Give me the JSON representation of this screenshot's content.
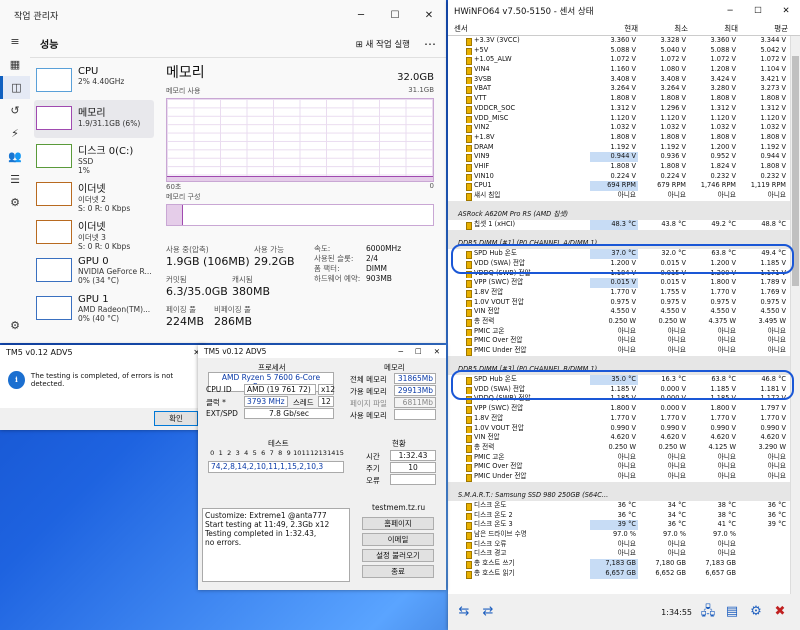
{
  "task_manager": {
    "title": "작업 관리자",
    "section": "성능",
    "new_task": "새 작업 실행",
    "items": [
      {
        "name": "CPU",
        "sub1": "2% 4.40GHz",
        "sub2": ""
      },
      {
        "name": "메모리",
        "sub1": "1.9/31.1GB (6%)",
        "sub2": ""
      },
      {
        "name": "디스크 0(C:)",
        "sub1": "SSD",
        "sub2": "1%"
      },
      {
        "name": "이더넷",
        "sub1": "이더넷 2",
        "sub2": "S: 0 R: 0 Kbps"
      },
      {
        "name": "이더넷",
        "sub1": "이더넷 3",
        "sub2": "S: 0 R: 0 Kbps"
      },
      {
        "name": "GPU 0",
        "sub1": "NVIDIA GeForce R...",
        "sub2": "0% (34 °C)"
      },
      {
        "name": "GPU 1",
        "sub1": "AMD Radeon(TM)...",
        "sub2": "0% (40 °C)"
      }
    ],
    "detail": {
      "heading": "메모리",
      "capacity": "32.0GB",
      "usage_label": "메모리 사용",
      "usage_max": "31.1GB",
      "axis_left": "60초",
      "axis_right": "0",
      "composition": "메모리 구성",
      "in_use_label": "사용 중(압축)",
      "in_use": "1.9GB (106MB)",
      "available_label": "사용 가능",
      "available": "29.2GB",
      "committed_label": "커밋됨",
      "committed": "6.3/35.0GB",
      "cached_label": "캐시됨",
      "cached": "380MB",
      "paged_label": "페이징 풀",
      "paged": "224MB",
      "nonpaged_label": "비페이징 풀",
      "nonpaged": "286MB",
      "speed_k": "속도:",
      "speed_v": "6000MHz",
      "slots_k": "사용된 슬롯:",
      "slots_v": "2/4",
      "form_k": "폼 팩터:",
      "form_v": "DIMM",
      "hwres_k": "하드웨어 예약:",
      "hwres_v": "903MB"
    }
  },
  "hwinfo": {
    "title": "HWiNFO64 v7.50-5150 - 센서 상태",
    "headers": [
      "센서",
      "현재",
      "최소",
      "최대",
      "평균"
    ],
    "rows": [
      [
        "+3.3V (3VCC)",
        "3.360 V",
        "3.328 V",
        "3.360 V",
        "3.344 V",
        ""
      ],
      [
        "+5V",
        "5.088 V",
        "5.040 V",
        "5.088 V",
        "5.042 V",
        ""
      ],
      [
        "+1.05_ALW",
        "1.072 V",
        "1.072 V",
        "1.072 V",
        "1.072 V",
        ""
      ],
      [
        "VIN4",
        "1.160 V",
        "1.080 V",
        "1.208 V",
        "1.104 V",
        ""
      ],
      [
        "3VSB",
        "3.408 V",
        "3.408 V",
        "3.424 V",
        "3.421 V",
        ""
      ],
      [
        "VBAT",
        "3.264 V",
        "3.264 V",
        "3.280 V",
        "3.273 V",
        ""
      ],
      [
        "VTT",
        "1.808 V",
        "1.808 V",
        "1.808 V",
        "1.808 V",
        ""
      ],
      [
        "VDDCR_SOC",
        "1.312 V",
        "1.296 V",
        "1.312 V",
        "1.312 V",
        ""
      ],
      [
        "VDD_MISC",
        "1.120 V",
        "1.120 V",
        "1.120 V",
        "1.120 V",
        ""
      ],
      [
        "VIN2",
        "1.032 V",
        "1.032 V",
        "1.032 V",
        "1.032 V",
        ""
      ],
      [
        "+1.8V",
        "1.808 V",
        "1.808 V",
        "1.808 V",
        "1.808 V",
        ""
      ],
      [
        "DRAM",
        "1.192 V",
        "1.192 V",
        "1.200 V",
        "1.192 V",
        ""
      ],
      [
        "VIN9",
        "0.944 V",
        "0.936 V",
        "0.952 V",
        "0.944 V",
        "hl"
      ],
      [
        "VHIF",
        "1.808 V",
        "1.808 V",
        "1.824 V",
        "1.808 V",
        ""
      ],
      [
        "VIN10",
        "0.224 V",
        "0.224 V",
        "0.232 V",
        "0.232 V",
        ""
      ],
      [
        "CPU1",
        "694 RPM",
        "679 RPM",
        "1,746 RPM",
        "1,119 RPM",
        "hl"
      ],
      [
        "섀시 침입",
        "아니요",
        "아니요",
        "아니요",
        "아니요",
        ""
      ],
      [
        "",
        "",
        "",
        "",
        "",
        "empty"
      ],
      [
        "ASRock A620M Pro RS (AMD 칩셋)",
        "",
        "",
        "",
        "",
        "group"
      ],
      [
        "칩셋 1 (xHCI)",
        "48.3 °C",
        "43.8 °C",
        "49.2 °C",
        "48.8 °C",
        "hl"
      ],
      [
        "",
        "",
        "",
        "",
        "",
        "empty"
      ],
      [
        "DDR5 DIMM [#1] (P0 CHANNEL A/DIMM 1)",
        "",
        "",
        "",
        "",
        "group"
      ],
      [
        "SPD Hub 온도",
        "37.0 °C",
        "32.0 °C",
        "63.8 °C",
        "49.4 °C",
        "hl"
      ],
      [
        "VDD (SWA) 전압",
        "1.200 V",
        "0.015 V",
        "1.200 V",
        "1.185 V",
        ""
      ],
      [
        "VDDQ (SWB) 전압",
        "1.184 V",
        "0.015 V",
        "1.200 V",
        "1.171 V",
        ""
      ],
      [
        "VPP (SWC) 전압",
        "0.015 V",
        "0.015 V",
        "1.800 V",
        "1.789 V",
        "hl"
      ],
      [
        "1.8V 전압",
        "1.770 V",
        "1.755 V",
        "1.770 V",
        "1.769 V",
        ""
      ],
      [
        "1.0V VOUT 전압",
        "0.975 V",
        "0.975 V",
        "0.975 V",
        "0.975 V",
        ""
      ],
      [
        "VIN 전압",
        "4.550 V",
        "4.550 V",
        "4.550 V",
        "4.550 V",
        ""
      ],
      [
        "총 전력",
        "0.250 W",
        "0.250 W",
        "4.375 W",
        "3.495 W",
        ""
      ],
      [
        "PMIC 고온",
        "아니요",
        "아니요",
        "아니요",
        "아니요",
        ""
      ],
      [
        "PMIC Over 전압",
        "아니요",
        "아니요",
        "아니요",
        "아니요",
        ""
      ],
      [
        "PMIC Under 전압",
        "아니요",
        "아니요",
        "아니요",
        "아니요",
        ""
      ],
      [
        "",
        "",
        "",
        "",
        "",
        "empty"
      ],
      [
        "DDR5 DIMM [#3] (P0 CHANNEL B/DIMM 1)",
        "",
        "",
        "",
        "",
        "group"
      ],
      [
        "SPD Hub 온도",
        "35.0 °C",
        "16.3 °C",
        "63.8 °C",
        "46.8 °C",
        "hl"
      ],
      [
        "VDD (SWA) 전압",
        "1.185 V",
        "0.000 V",
        "1.185 V",
        "1.181 V",
        ""
      ],
      [
        "VDDQ (SWB) 전압",
        "1.185 V",
        "0.000 V",
        "1.185 V",
        "1.172 V",
        ""
      ],
      [
        "VPP (SWC) 전압",
        "1.800 V",
        "0.000 V",
        "1.800 V",
        "1.797 V",
        ""
      ],
      [
        "1.8V 전압",
        "1.770 V",
        "1.770 V",
        "1.770 V",
        "1.770 V",
        ""
      ],
      [
        "1.0V VOUT 전압",
        "0.990 V",
        "0.990 V",
        "0.990 V",
        "0.990 V",
        ""
      ],
      [
        "VIN 전압",
        "4.620 V",
        "4.620 V",
        "4.620 V",
        "4.620 V",
        ""
      ],
      [
        "총 전력",
        "0.250 W",
        "0.250 W",
        "4.125 W",
        "3.290 W",
        ""
      ],
      [
        "PMIC 고온",
        "아니요",
        "아니요",
        "아니요",
        "아니요",
        ""
      ],
      [
        "PMIC Over 전압",
        "아니요",
        "아니요",
        "아니요",
        "아니요",
        ""
      ],
      [
        "PMIC Under 전압",
        "아니요",
        "아니요",
        "아니요",
        "아니요",
        ""
      ],
      [
        "",
        "",
        "",
        "",
        "",
        "empty"
      ],
      [
        "S.M.A.R.T.: Samsung SSD 980 250GB (S64C...",
        "",
        "",
        "",
        "",
        "group"
      ],
      [
        "디스크 온도",
        "36 °C",
        "34 °C",
        "38 °C",
        "36 °C",
        ""
      ],
      [
        "디스크 온도 2",
        "36 °C",
        "34 °C",
        "38 °C",
        "36 °C",
        ""
      ],
      [
        "디스크 온도 3",
        "39 °C",
        "36 °C",
        "41 °C",
        "39 °C",
        "hl"
      ],
      [
        "남은 드라이브 수명",
        "97.0 %",
        "97.0 %",
        "97.0 %",
        "",
        ""
      ],
      [
        "디스크 오류",
        "아니요",
        "아니요",
        "아니요",
        "",
        ""
      ],
      [
        "디스크 경고",
        "아니요",
        "아니요",
        "아니요",
        "",
        ""
      ],
      [
        "총 호스트 쓰기",
        "7,183 GB",
        "7,180 GB",
        "7,183 GB",
        "",
        "hl"
      ],
      [
        "총 호스트 읽기",
        "6,657 GB",
        "6,652 GB",
        "6,657 GB",
        "",
        "hl"
      ]
    ],
    "time": "1:34:55"
  },
  "tm5_dialog": {
    "title": "TM5 v0.12 ADV5",
    "message": "The testing is completed, of errors is not detected.",
    "ok": "확인"
  },
  "tm5": {
    "title": "TM5 v0.12 ADV5",
    "proc_label": "프로세서",
    "cpu_id_k": "CPU ID",
    "cpu_id": "AMD  (19 761 72)",
    "threads": "x12",
    "clock_k": "클럭 *",
    "clock": "3793 MHz",
    "thread_k": "스레드",
    "thread_v": "12",
    "ext_k": "EXT/SPD",
    "ext": "7.8 Gb/sec",
    "cpu_name": "AMD Ryzen 5 7600 6-Core Processor",
    "mem_label": "메모리",
    "total_k": "전체 메모리",
    "total": "31865Mb",
    "avail_k": "가용 메모리",
    "avail": "29913Mb",
    "page_k": "페이지 파일",
    "page": "6811Mb",
    "used_k": "사용 메모리",
    "test_label": "테스트",
    "test_nums": [
      "0",
      "1",
      "2",
      "3",
      "4",
      "5",
      "6",
      "7",
      "8",
      "9",
      "10",
      "11",
      "12",
      "13",
      "14",
      "15"
    ],
    "test_seq": "74,2,8,14,2,10,11,1,15,2,10,3",
    "status_label": "현황",
    "time_k": "시간",
    "time": "1:32.43",
    "cycle_k": "주기",
    "cycle": "10",
    "err_k": "오류",
    "err": "",
    "log": [
      "Customize: Extreme1 @anta777",
      "Start testing at 11:49, 2.3Gb x12",
      "Testing completed in 1:32.43,",
      "no errors."
    ],
    "site": "testmem.tz.ru",
    "buttons": [
      "홈페이지",
      "이메일",
      "설정 불러오기",
      "종료"
    ]
  }
}
